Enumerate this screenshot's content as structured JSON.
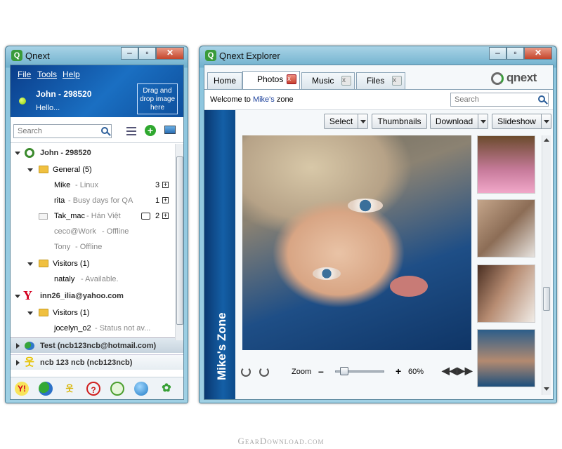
{
  "left_window": {
    "title": "Qnext",
    "menu": [
      "File",
      "Tools",
      "Help"
    ],
    "user_name": "John - 298520",
    "user_status": "Hello...",
    "drop_box": "Drag and drop image here",
    "search_placeholder": "Search",
    "tree": {
      "root": "John - 298520",
      "group_general": "General (5)",
      "contacts": [
        {
          "name": "Mike",
          "status": "- Linux",
          "count": "3"
        },
        {
          "name": "rita",
          "status": "- Busy days for QA",
          "count": "1"
        },
        {
          "name": "Tak_mac",
          "status": "- Hán Việt",
          "count": "2"
        },
        {
          "name": "ceco@Work",
          "status": "- Offline",
          "count": ""
        },
        {
          "name": "Tony",
          "status": "- Offline",
          "count": ""
        }
      ],
      "group_visitors_1": "Visitors (1)",
      "visitor_1": {
        "name": "nataly",
        "status": "- Available."
      },
      "yahoo_account": "inn26_ilia@yahoo.com",
      "group_visitors_2": "Visitors (1)",
      "visitor_2": {
        "name": "jocelyn_o2",
        "status": "- Status not av..."
      },
      "msn_account": "Test (ncb123ncb@hotmail.com)",
      "aim_account": "ncb  123  ncb (ncb123ncb)"
    },
    "bottom_icons": [
      "yahoo-icon",
      "msn-buddies-icon",
      "aim-runner-icon",
      "question-icon",
      "chat-bubble-icon",
      "chat-icon",
      "icq-flower-icon"
    ]
  },
  "right_window": {
    "title": "Qnext Explorer",
    "tabs": [
      {
        "label": "Home",
        "active": false,
        "closable": false
      },
      {
        "label": "Photos",
        "active": true,
        "closable": true
      },
      {
        "label": "Music",
        "active": false,
        "closable": true
      },
      {
        "label": "Files",
        "active": false,
        "closable": true
      }
    ],
    "brand": "qnext",
    "welcome_prefix": "Welcome to ",
    "welcome_link": "Mike's",
    "welcome_suffix": " zone",
    "search_placeholder": "Search",
    "toolbar": {
      "select": "Select",
      "thumbnails": "Thumbnails",
      "download": "Download",
      "slideshow": "Slideshow"
    },
    "sidebar_label": "Mike's Zone",
    "zoom_label": "Zoom",
    "zoom_value": "60%",
    "zoom_level": 0.1,
    "thumbnail_count": 4
  },
  "watermark": "GearDownload.com",
  "colors": {
    "accent_blue": "#1a4fa0",
    "window_frame": "#7fb8d2",
    "brand_green": "#3a9b3a"
  }
}
